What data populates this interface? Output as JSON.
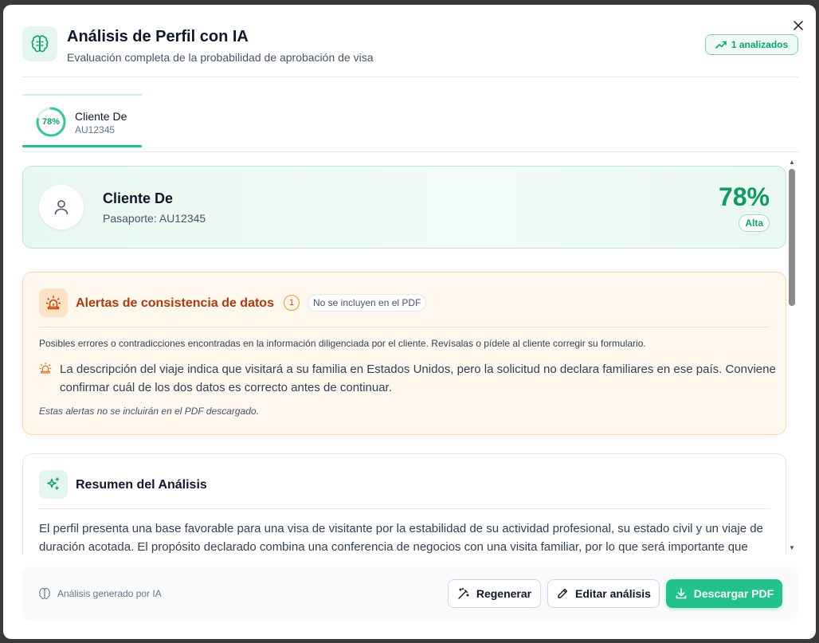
{
  "dialog": {
    "title": "Análisis de Perfil con IA",
    "subtitle": "Evaluación completa de la probabilidad de aprobación de visa",
    "analyzed_badge": "1 analizados"
  },
  "client_tabs": [
    {
      "score": "78%",
      "name": "Cliente De",
      "passport": "AU12345",
      "progress": 0.78
    }
  ],
  "profile": {
    "name": "Cliente De",
    "passport_line": "Pasaporte: AU12345",
    "score": "78%",
    "level": "Alta"
  },
  "alerts": {
    "title": "Alertas de consistencia de datos",
    "count": "1",
    "pdf_tag": "No se incluyen en el PDF",
    "description": "Posibles errores o contradicciones encontradas en la información diligenciada por el cliente. Revísalas o pídele al cliente corregir su formulario.",
    "items": [
      "La descripción del viaje indica que visitará a su familia en Estados Unidos, pero la solicitud no declara familiares en ese país. Conviene confirmar cuál de los dos datos es correcto antes de continuar."
    ],
    "footnote": "Estas alertas no se incluirán en el PDF descargado."
  },
  "summary": {
    "title": "Resumen del Análisis",
    "text": "El perfil presenta una base favorable para una visa de visitante por la estabilidad de su actividad profesional, su estado civil y un viaje de duración acotada. El propósito declarado combina una conferencia de negocios con una visita familiar, por lo que será importante que"
  },
  "footer": {
    "note": "Análisis generado por IA",
    "regenerate": "Regenerar",
    "edit": "Editar análisis",
    "download": "Descargar PDF"
  },
  "colors": {
    "accent": "#22c38a",
    "accent_text": "#10a36a",
    "alert_title": "#b03a0e",
    "alert_bg": "#fff8ef"
  }
}
